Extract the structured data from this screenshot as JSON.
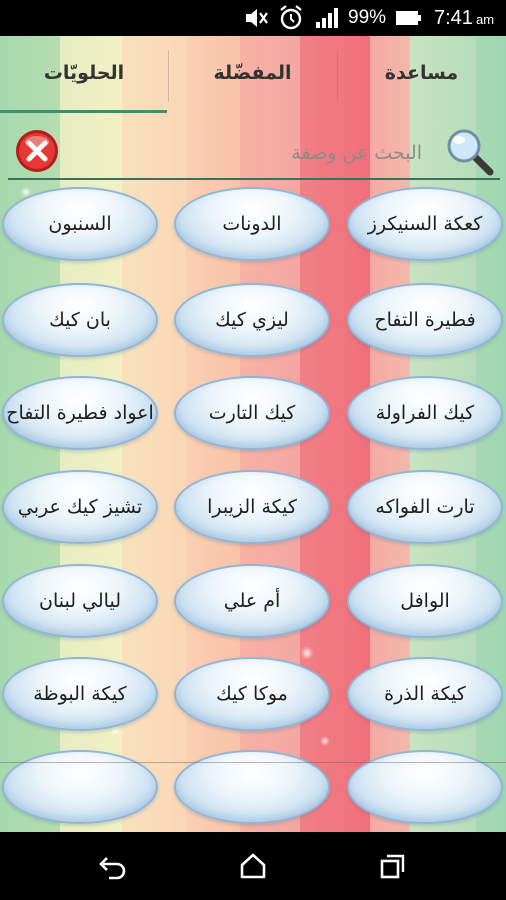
{
  "status_bar": {
    "battery_percent": "99%",
    "time": "7:41",
    "time_suffix": "am",
    "icons": [
      "mute-icon",
      "alarm-icon",
      "signal-icon",
      "battery-icon"
    ]
  },
  "tabs": [
    {
      "label": "مساعدة",
      "selected": false
    },
    {
      "label": "المفضّلة",
      "selected": false
    },
    {
      "label": "الحلويّات",
      "selected": true
    }
  ],
  "search": {
    "placeholder": "البحث عن وصفة",
    "value": ""
  },
  "recipes": [
    [
      "كعكة السنيكرز",
      "الدونات",
      "السنبون"
    ],
    [
      "فطيرة التفاح",
      "ليزي كيك",
      "بان كيك"
    ],
    [
      "كيك الفراولة",
      "كيك التارت",
      "اعواد فطيرة التفاح"
    ],
    [
      "تارت الفواكه",
      "كيكة الزيبرا",
      "تشيز كيك عربي"
    ],
    [
      "الوافل",
      "أم علي",
      "ليالي لبنان"
    ],
    [
      "كيكة الذرة",
      "موكا كيك",
      "كيكة البوظة"
    ]
  ],
  "colors": {
    "tab_underline": "#3e8f6e",
    "bubble_border": "#8fb6d8",
    "clear_button": "#e53935"
  },
  "nav_bar": {
    "icons": [
      "back-icon",
      "home-icon",
      "recent-apps-icon"
    ]
  }
}
